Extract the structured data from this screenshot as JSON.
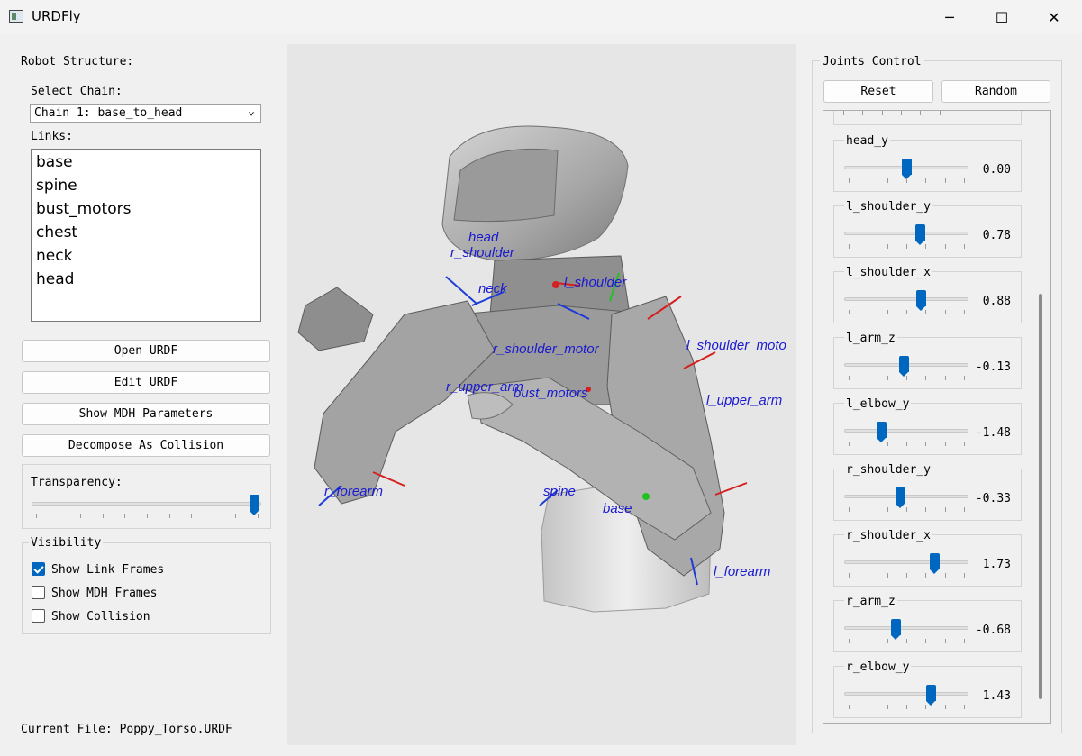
{
  "window": {
    "title": "URDFly",
    "minimize": "─",
    "maximize": "☐",
    "close": "✕"
  },
  "left": {
    "robot_structure_label": "Robot Structure:",
    "select_chain_label": "Select Chain:",
    "chain_selected": "Chain 1: base_to_head",
    "links_label": "Links:",
    "links": [
      "base",
      "spine",
      "bust_motors",
      "chest",
      "neck",
      "head"
    ],
    "buttons": {
      "open": "Open URDF",
      "edit": "Edit URDF",
      "mdh": "Show MDH Parameters",
      "decompose": "Decompose As Collision"
    },
    "transparency_label": "Transparency:",
    "transparency_value": 1.0,
    "visibility_label": "Visibility",
    "checkboxes": [
      {
        "label": "Show Link Frames",
        "checked": true
      },
      {
        "label": "Show MDH Frames",
        "checked": false
      },
      {
        "label": "Show Collision",
        "checked": false
      }
    ],
    "current_file": "Current File: Poppy_Torso.URDF"
  },
  "viewport": {
    "frame_labels": {
      "head": "head",
      "r_shoulder": "r_shoulder",
      "neck": "neck",
      "l_shoulder": "l_shoulder",
      "r_shoulder_motor": "r_shoulder_motor",
      "l_shoulder_motor": "l_shoulder_moto",
      "r_upper_arm": "r_upper_arm",
      "bust_motors": "bust_motors",
      "l_upper_arm": "l_upper_arm",
      "r_forearm": "r_forearm",
      "spine": "spine",
      "base": "base",
      "l_forearm": "l_forearm"
    }
  },
  "joints_control": {
    "title": "Joints Control",
    "reset": "Reset",
    "random": "Random",
    "joints": [
      {
        "name": "head_y",
        "value": "0.00",
        "pos": 0.5
      },
      {
        "name": "l_shoulder_y",
        "value": "0.78",
        "pos": 0.62
      },
      {
        "name": "l_shoulder_x",
        "value": "0.88",
        "pos": 0.63
      },
      {
        "name": "l_arm_z",
        "value": "-0.13",
        "pos": 0.48
      },
      {
        "name": "l_elbow_y",
        "value": "-1.48",
        "pos": 0.28
      },
      {
        "name": "r_shoulder_y",
        "value": "-0.33",
        "pos": 0.45
      },
      {
        "name": "r_shoulder_x",
        "value": "1.73",
        "pos": 0.75
      },
      {
        "name": "r_arm_z",
        "value": "-0.68",
        "pos": 0.41
      },
      {
        "name": "r_elbow_y",
        "value": "1.43",
        "pos": 0.72
      }
    ]
  }
}
